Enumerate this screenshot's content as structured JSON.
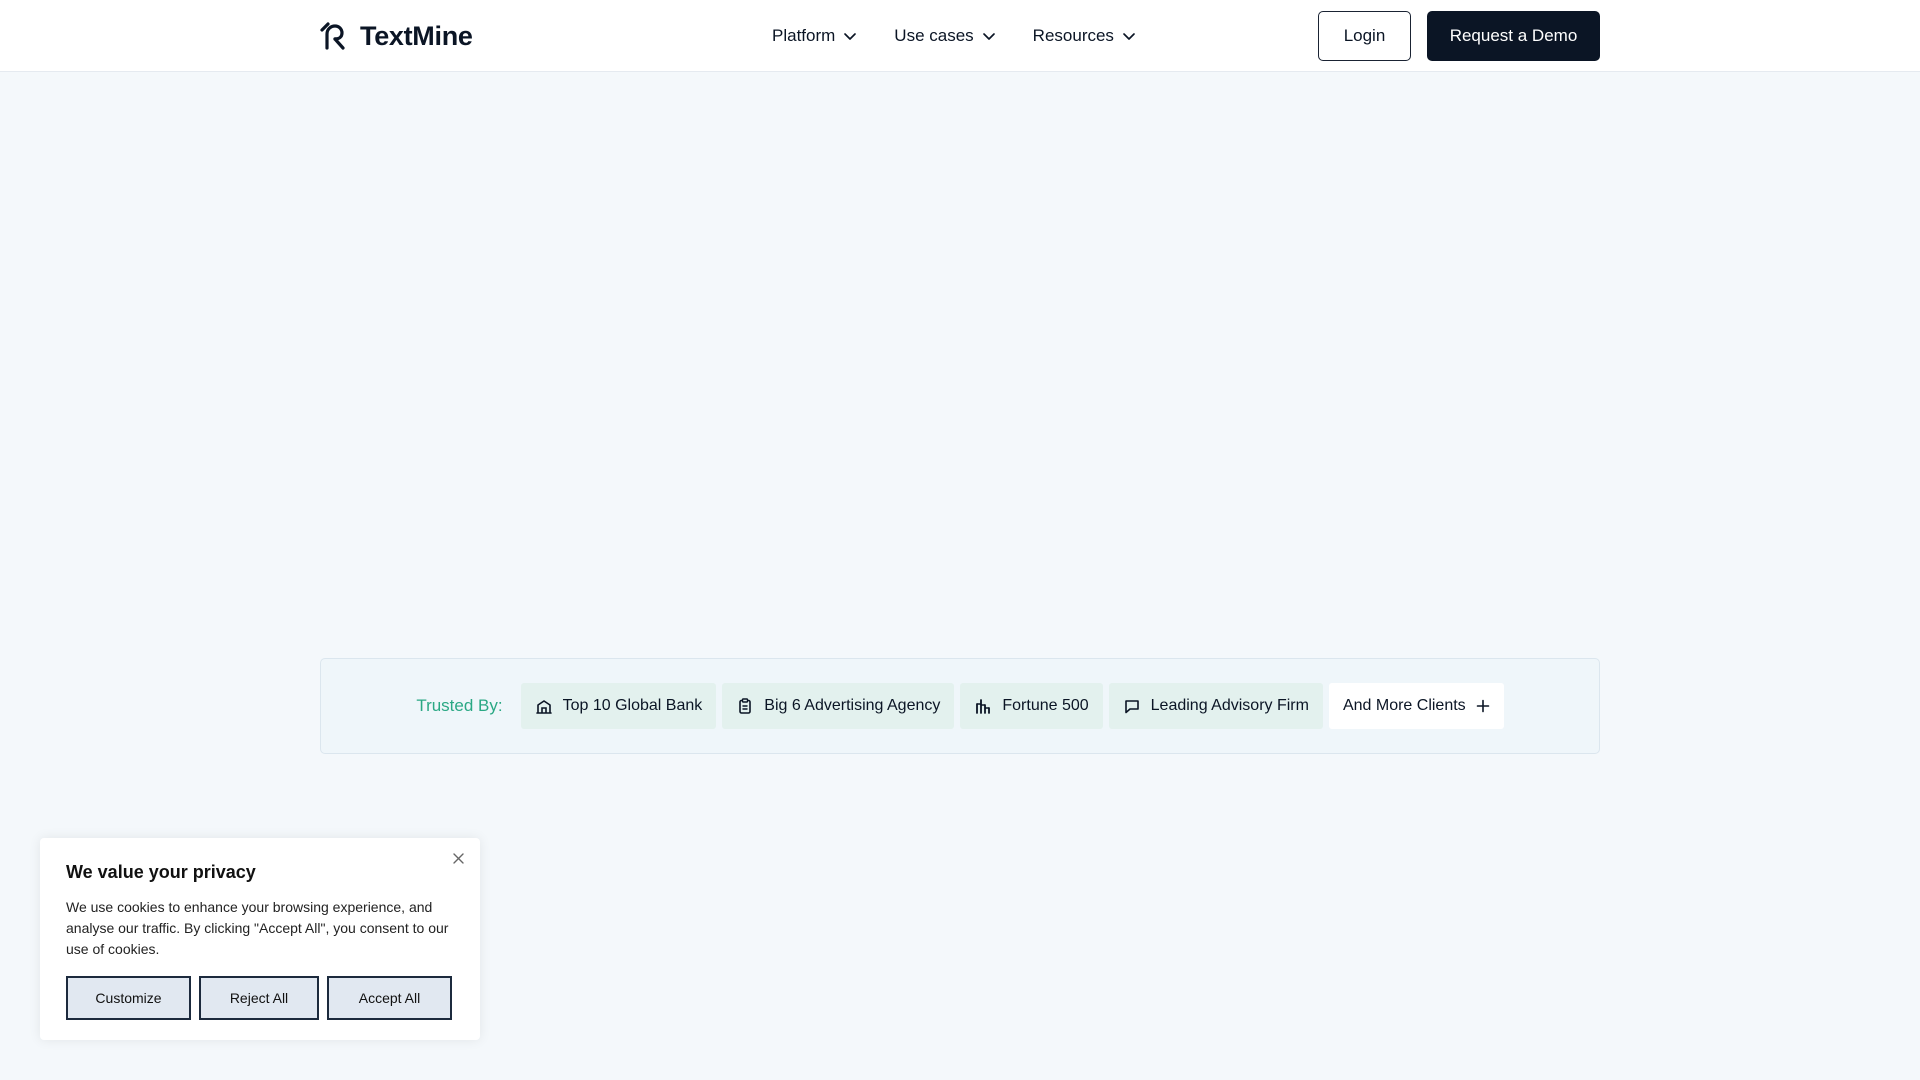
{
  "header": {
    "logo_text": "TextMine",
    "nav": [
      {
        "label": "Platform"
      },
      {
        "label": "Use cases"
      },
      {
        "label": "Resources"
      }
    ],
    "login_label": "Login",
    "demo_label": "Request a Demo"
  },
  "trusted": {
    "label": "Trusted By:",
    "chips": [
      {
        "label": "Top 10 Global Bank",
        "icon": "bank-icon"
      },
      {
        "label": "Big 6 Advertising Agency",
        "icon": "clipboard-icon"
      },
      {
        "label": "Fortune 500",
        "icon": "bar-chart-icon"
      },
      {
        "label": "Leading Advisory Firm",
        "icon": "message-icon"
      }
    ],
    "more_label": "And More Clients",
    "more_icon": "plus-icon"
  },
  "cookie": {
    "title": "We value your privacy",
    "text": "We use cookies to enhance your browsing experience, and analyse our traffic. By clicking \"Accept All\", you consent to our use of cookies.",
    "customize_label": "Customize",
    "reject_label": "Reject All",
    "accept_label": "Accept All"
  },
  "colors": {
    "brand_dark": "#0b1525",
    "accent_green": "#2aa884",
    "page_bg": "#f4f8fb"
  }
}
